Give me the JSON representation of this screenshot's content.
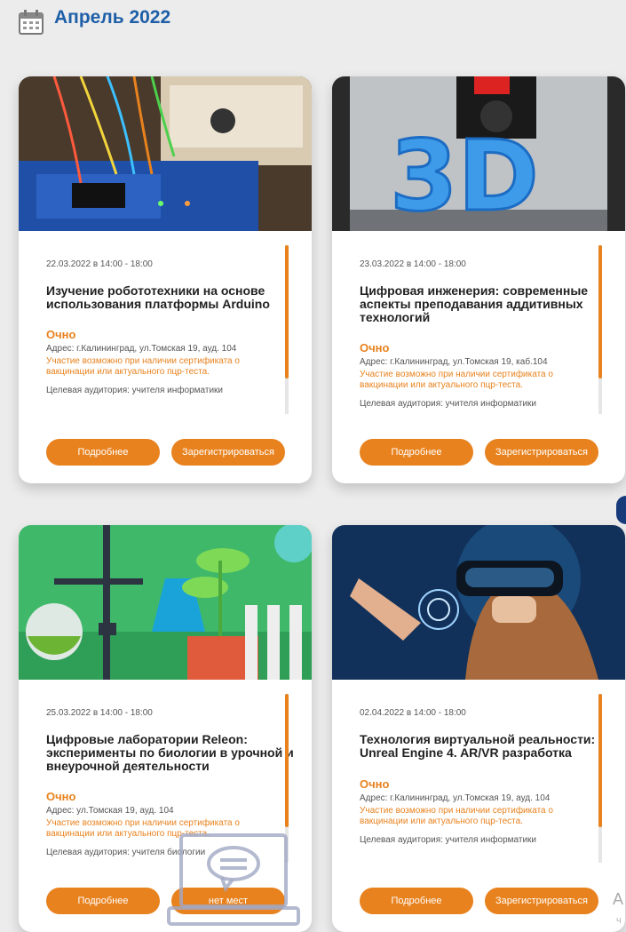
{
  "header": {
    "month": "Апрель 2022"
  },
  "cards": [
    {
      "date": "22.03.2022 в 14:00 - 18:00",
      "title": "Изучение робототехники на основе использования платформы Arduino",
      "mode": "Очно",
      "address": "Адрес:   г.Калининград, ул.Томская 19, ауд. 104",
      "warning": "Участие возможно при наличии сертификата о вакцинации или актуального пцр-теста.",
      "audience": "Целевая аудитория:   учителя информатики",
      "btn_more": "Подробнее",
      "btn_reg": "Зарегистрироваться"
    },
    {
      "date": "23.03.2022 в 14:00 - 18:00",
      "title": "Цифровая инженерия: современные аспекты преподавания аддитивных технологий",
      "mode": "Очно",
      "address": "Адрес:   г.Калининград, ул.Томская 19, каб.104",
      "warning": "Участие возможно при наличии сертификата о вакцинации или актуального пцр-теста.",
      "audience": "Целевая аудитория:   учителя информатики",
      "btn_more": "Подробнее",
      "btn_reg": "Зарегистрироваться"
    },
    {
      "date": "25.03.2022 в 14:00 - 18:00",
      "title": "Цифровые лаборатории Releon: эксперименты по биологии в урочной и внеурочной деятельности",
      "mode": "Очно",
      "address": "Адрес:   ул.Томская 19, ауд. 104",
      "warning": "Участие возможно при наличии сертификата о вакцинации или актуального пцр-теста.",
      "audience": "Целевая аудитория:   учителя биологии",
      "btn_more": "Подробнее",
      "btn_reg": "нет мест"
    },
    {
      "date": "02.04.2022 в 14:00 - 18:00",
      "title": "Технология виртуальной реальности: Unreal Engine 4. AR/VR разработка",
      "mode": "Очно",
      "address": "Адрес:   г.Калининград, ул.Томская 19, ауд. 104",
      "warning": "Участие возможно при наличии сертификата о вакцинации или актуального пцр-теста.",
      "audience": "Целевая аудитория:   учителя информатики",
      "btn_more": "Подробнее",
      "btn_reg": "Зарегистрироваться"
    }
  ],
  "side": {
    "letter": "А",
    "small": "ч"
  },
  "colors": {
    "accent": "#e8821e",
    "heading": "#1e5fa8",
    "dark_blue": "#163a7a"
  }
}
